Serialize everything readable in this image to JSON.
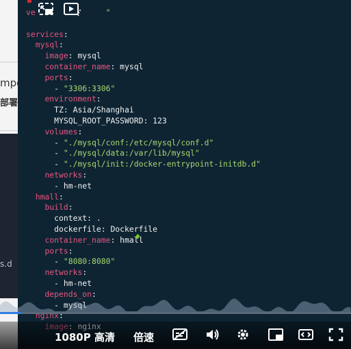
{
  "background": {
    "fragment_1": "mpo",
    "fragment_2": "部署",
    "fragment_3": "s.d"
  },
  "editor": {
    "lines": [
      [
        {
          "c": "k1",
          "t": "ve"
        },
        {
          "c": "s",
          "t": "               \""
        }
      ],
      [
        {
          "c": "d",
          "t": ""
        }
      ],
      [
        {
          "c": "k1",
          "t": "services"
        },
        {
          "c": "p",
          "t": ":"
        }
      ],
      [
        {
          "c": "d",
          "t": "  "
        },
        {
          "c": "k1",
          "t": "mysql"
        },
        {
          "c": "p",
          "t": ":"
        }
      ],
      [
        {
          "c": "d",
          "t": "    "
        },
        {
          "c": "k2",
          "t": "image"
        },
        {
          "c": "p",
          "t": ": "
        },
        {
          "c": "v",
          "t": "mysql"
        }
      ],
      [
        {
          "c": "d",
          "t": "    "
        },
        {
          "c": "k2",
          "t": "container_name"
        },
        {
          "c": "p",
          "t": ": "
        },
        {
          "c": "v",
          "t": "mysql"
        }
      ],
      [
        {
          "c": "d",
          "t": "    "
        },
        {
          "c": "k2",
          "t": "ports"
        },
        {
          "c": "p",
          "t": ":"
        }
      ],
      [
        {
          "c": "d",
          "t": "      - "
        },
        {
          "c": "s",
          "t": "\"3306:3306\""
        }
      ],
      [
        {
          "c": "d",
          "t": "    "
        },
        {
          "c": "k2",
          "t": "environment"
        },
        {
          "c": "p",
          "t": ":"
        }
      ],
      [
        {
          "c": "d",
          "t": "      "
        },
        {
          "c": "v",
          "t": "TZ: Asia/Shanghai"
        }
      ],
      [
        {
          "c": "d",
          "t": "      "
        },
        {
          "c": "v",
          "t": "MYSQL_ROOT_PASSWORD: 123"
        }
      ],
      [
        {
          "c": "d",
          "t": "    "
        },
        {
          "c": "k2",
          "t": "volumes"
        },
        {
          "c": "p",
          "t": ":"
        }
      ],
      [
        {
          "c": "d",
          "t": "      - "
        },
        {
          "c": "s",
          "t": "\"./mysql/conf:/etc/mysql/conf.d\""
        }
      ],
      [
        {
          "c": "d",
          "t": "      - "
        },
        {
          "c": "s",
          "t": "\"./mysql/data:/var/lib/mysql\""
        }
      ],
      [
        {
          "c": "d",
          "t": "      - "
        },
        {
          "c": "s",
          "t": "\"./mysql/init:/docker-entrypoint-initdb.d\""
        }
      ],
      [
        {
          "c": "d",
          "t": "    "
        },
        {
          "c": "k2",
          "t": "networks"
        },
        {
          "c": "p",
          "t": ":"
        }
      ],
      [
        {
          "c": "d",
          "t": "      - hm-net"
        }
      ],
      [
        {
          "c": "d",
          "t": "  "
        },
        {
          "c": "k1",
          "t": "hmall"
        },
        {
          "c": "p",
          "t": ":"
        }
      ],
      [
        {
          "c": "d",
          "t": "    "
        },
        {
          "c": "k2",
          "t": "build"
        },
        {
          "c": "p",
          "t": ":"
        }
      ],
      [
        {
          "c": "d",
          "t": "      context: ."
        }
      ],
      [
        {
          "c": "d",
          "t": "      dockerfile: Dockerfile"
        }
      ],
      [
        {
          "c": "d",
          "t": "    "
        },
        {
          "c": "k2",
          "t": "container_name"
        },
        {
          "c": "p",
          "t": ": "
        },
        {
          "c": "v",
          "t": "hmall"
        }
      ],
      [
        {
          "c": "d",
          "t": "    "
        },
        {
          "c": "k2",
          "t": "ports"
        },
        {
          "c": "p",
          "t": ":"
        }
      ],
      [
        {
          "c": "d",
          "t": "      - "
        },
        {
          "c": "s",
          "t": "\"8080:8080\""
        }
      ],
      [
        {
          "c": "d",
          "t": "    "
        },
        {
          "c": "k2",
          "t": "networks"
        },
        {
          "c": "p",
          "t": ":"
        }
      ],
      [
        {
          "c": "d",
          "t": "      - hm-net"
        }
      ],
      [
        {
          "c": "d",
          "t": "    "
        },
        {
          "c": "k2",
          "t": "depends_on"
        },
        {
          "c": "p",
          "t": ":"
        }
      ],
      [
        {
          "c": "d",
          "t": "      - mysql"
        }
      ],
      [
        {
          "c": "d",
          "t": "  "
        },
        {
          "c": "k1",
          "t": "nginx"
        },
        {
          "c": "p",
          "t": ":"
        }
      ],
      [
        {
          "c": "d",
          "t": "    "
        },
        {
          "c": "k2",
          "t": "image"
        },
        {
          "c": "p",
          "t": ": "
        },
        {
          "c": "v",
          "t": "nginx"
        }
      ]
    ]
  },
  "player": {
    "progress": 0.06,
    "quality_label": "1080P 高清",
    "speed_label": "倍速",
    "icons": [
      "picture-in-picture-icon",
      "autoplay-icon",
      "subtitle-icon",
      "volume-icon",
      "settings-icon",
      "miniplayer-icon",
      "theater-mode-icon",
      "fullscreen-icon"
    ]
  },
  "colors": {
    "editor_bg": "#0e2433",
    "key": "#ec4f7b",
    "string": "#a6d86e",
    "progress": "#2f7de1"
  }
}
